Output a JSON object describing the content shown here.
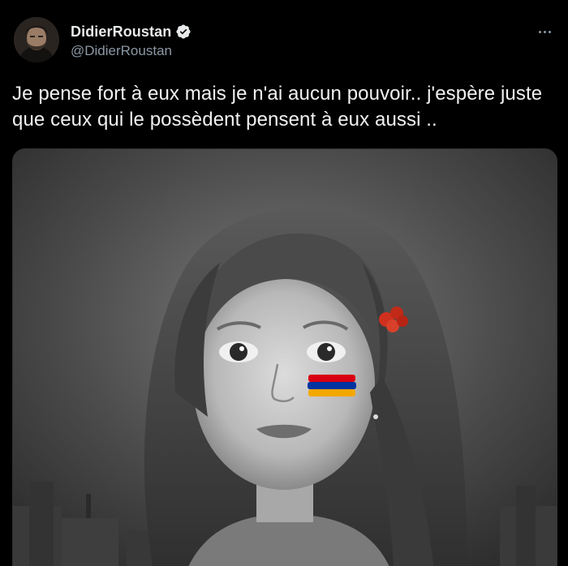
{
  "tweet": {
    "author": {
      "display_name": "DidierRoustan",
      "handle": "@DidierRoustan",
      "verified": true,
      "avatar_icon": "user-avatar"
    },
    "text": "Je pense fort à eux mais je n'ai aucun pouvoir.. j'espère juste que ceux qui le possèdent pensent à eux aussi ..",
    "more_icon": "more-horizontal-icon",
    "media": {
      "kind": "photo",
      "flag_colors": [
        "#d90012",
        "#0033a0",
        "#f2a800"
      ],
      "hair_clip_color": "#d0301e"
    }
  },
  "colors": {
    "background": "#000000",
    "text_primary": "#e7e9ea",
    "text_secondary": "#8b98a5",
    "verified_badge": "#e7e9ea"
  }
}
